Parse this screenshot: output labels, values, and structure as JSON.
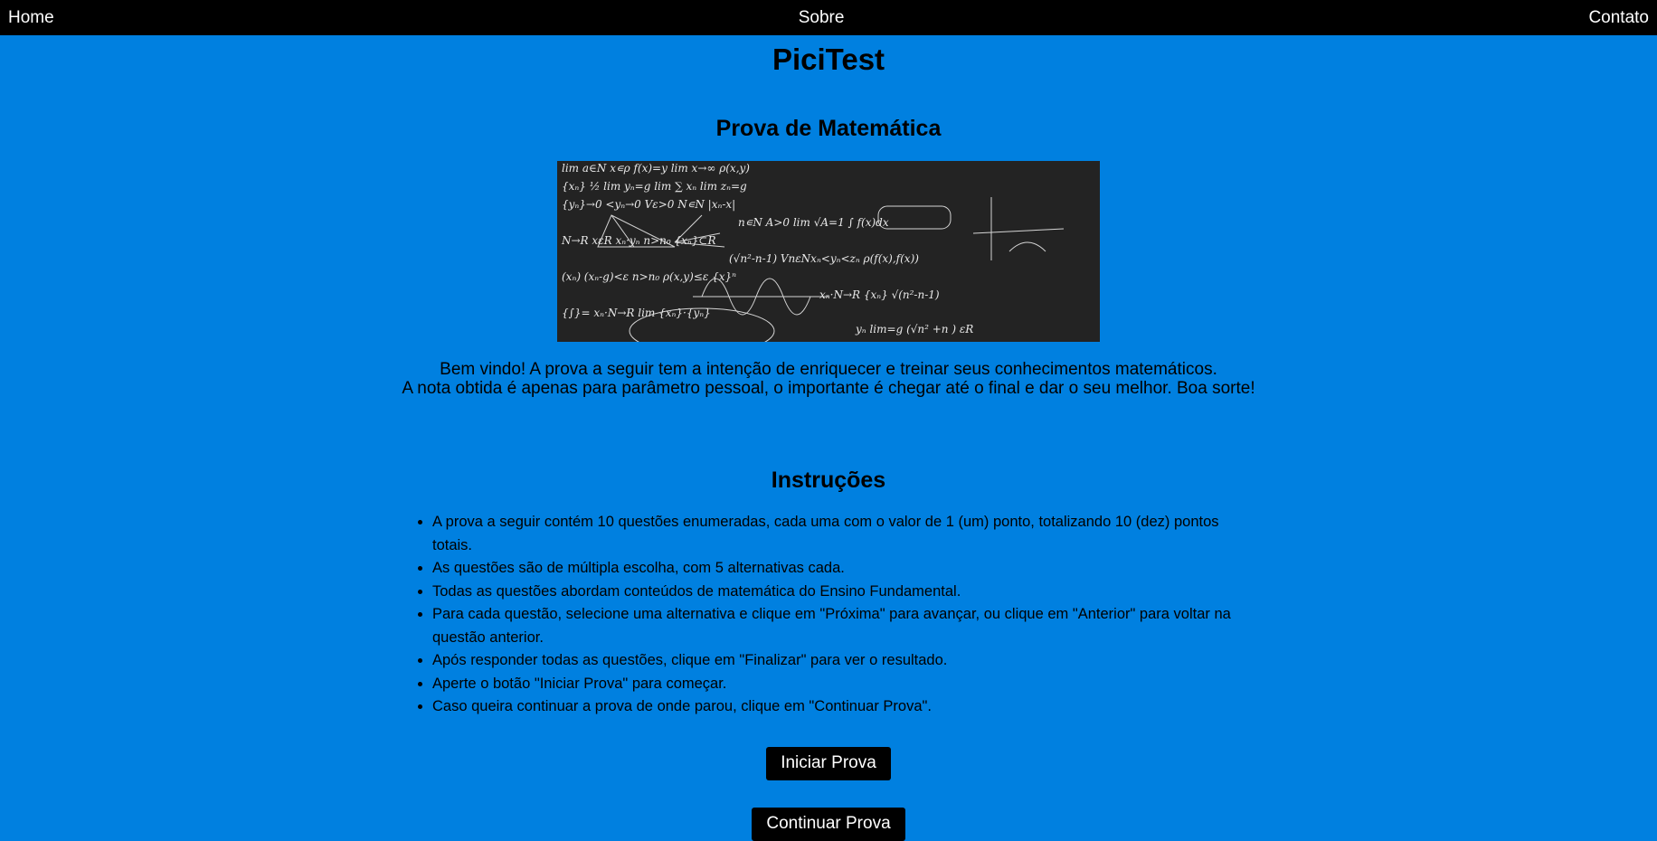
{
  "nav": {
    "home": "Home",
    "about": "Sobre",
    "contact": "Contato"
  },
  "site_title": "PiciTest",
  "exam_title": "Prova de Matemática",
  "banner_alt": "lousa com fórmulas matemáticas",
  "welcome": {
    "line1": "Bem vindo! A prova a seguir tem a intenção de enriquecer e treinar seus conhecimentos matemáticos.",
    "line2": "A nota obtida é apenas para parâmetro pessoal, o importante é chegar até o final e dar o seu melhor. Boa sorte!"
  },
  "instructions_title": "Instruções",
  "instructions": [
    "A prova a seguir contém 10 questões enumeradas, cada uma com o valor de 1 (um) ponto, totalizando 10 (dez) pontos totais.",
    "As questões são de múltipla escolha, com 5 alternativas cada.",
    "Todas as questões abordam conteúdos de matemática do Ensino Fundamental.",
    "Para cada questão, selecione uma alternativa e clique em \"Próxima\" para avançar, ou clique em \"Anterior\" para voltar na questão anterior.",
    "Após responder todas as questões, clique em \"Finalizar\" para ver o resultado.",
    "Aperte o botão \"Iniciar Prova\" para começar.",
    "Caso queira continuar a prova de onde parou, clique em \"Continuar Prova\"."
  ],
  "buttons": {
    "start": "Iniciar Prova",
    "continue": "Continuar Prova"
  },
  "colors": {
    "background": "#0080e0",
    "nav": "#000000",
    "button": "#000000",
    "banner": "#232323"
  }
}
